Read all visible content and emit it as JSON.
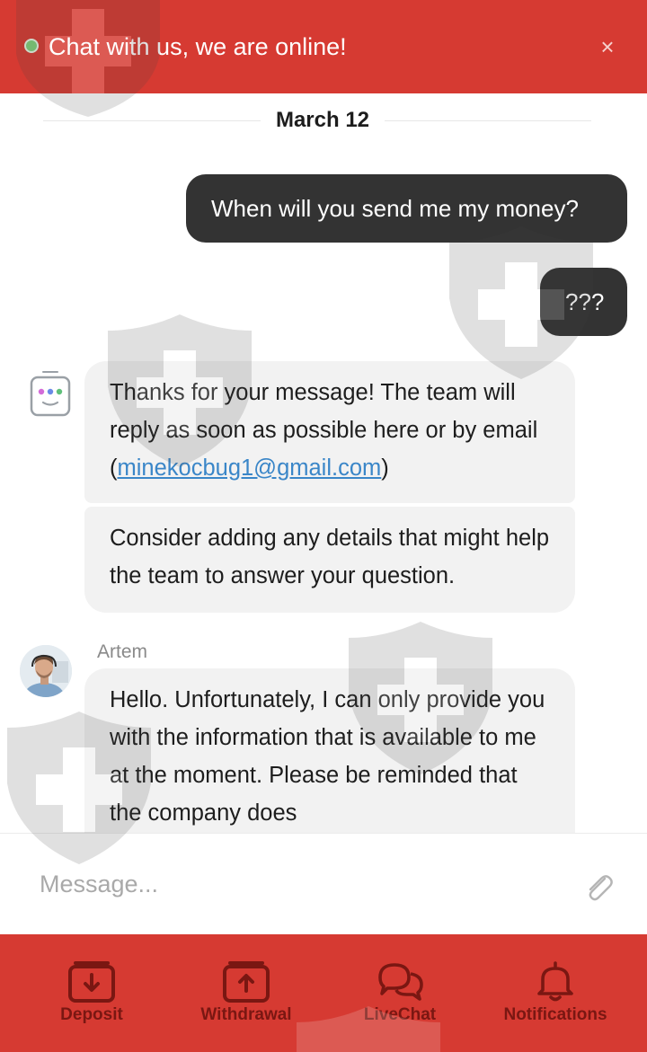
{
  "header": {
    "status_color": "#7fd07a",
    "title": "Chat with us, we are online!",
    "close_label": "×"
  },
  "chat": {
    "date": "March 12",
    "outgoing": [
      {
        "text": "When will you send me my money?"
      },
      {
        "text": "???"
      }
    ],
    "bot": {
      "icon": "bot-face-icon",
      "message1": {
        "text_before": "Thanks for your message! The team will reply as soon as possible here or by email (",
        "email": "minekocbug1@gmail.com",
        "text_after": ")"
      },
      "message2": "Consider adding any details that might help the team to answer your question."
    },
    "agent": {
      "name": "Artem",
      "message": "Hello. Unfortunately, I can only provide you with the information that is available to me at the moment. Please be reminded that the company does"
    }
  },
  "composer": {
    "placeholder": "Message...",
    "attach_icon": "paperclip-icon"
  },
  "nav": {
    "items": [
      {
        "label": "Deposit",
        "icon": "deposit-icon"
      },
      {
        "label": "Withdrawal",
        "icon": "withdrawal-icon"
      },
      {
        "label": "LiveChat",
        "icon": "chat-bubbles-icon"
      },
      {
        "label": "Notifications",
        "icon": "bell-icon"
      }
    ],
    "background": "#d63a32",
    "icon_color": "#7a1712"
  },
  "colors": {
    "brand_red": "#d63a32",
    "outgoing_bubble": "#333333",
    "incoming_bubble": "#f2f2f2",
    "link": "#3a86c8"
  }
}
